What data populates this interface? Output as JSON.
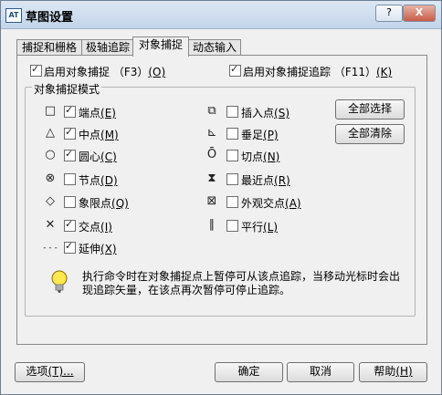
{
  "window": {
    "title": "草图设置",
    "app_icon_text": "AT",
    "help_btn": "?",
    "close_btn": "X"
  },
  "tabs": [
    {
      "label": "捕捉和栅格"
    },
    {
      "label": "极轴追踪"
    },
    {
      "label": "对象捕捉"
    },
    {
      "label": "动态输入"
    }
  ],
  "top_options": {
    "snap_on": {
      "label": "启用对象捕捉 （F3）",
      "mnem": "(O)",
      "checked": true
    },
    "track_on": {
      "label": "启用对象捕捉追踪 （F11）",
      "mnem": "(K)",
      "checked": true
    }
  },
  "group_title": "对象捕捉模式",
  "modes_left": [
    {
      "symbol": "□",
      "icon": "endpoint-icon",
      "label": "端点",
      "mnem": "(E)",
      "checked": true
    },
    {
      "symbol": "△",
      "icon": "midpoint-icon",
      "label": "中点",
      "mnem": "(M)",
      "checked": true
    },
    {
      "symbol": "○",
      "icon": "center-icon",
      "label": "圆心",
      "mnem": "(C)",
      "checked": true
    },
    {
      "symbol": "⊗",
      "icon": "node-icon",
      "label": "节点",
      "mnem": "(D)",
      "checked": false
    },
    {
      "symbol": "◇",
      "icon": "quadrant-icon",
      "label": "象限点",
      "mnem": "(Q)",
      "checked": false
    },
    {
      "symbol": "✕",
      "icon": "intersection-icon",
      "label": "交点",
      "mnem": "(I)",
      "checked": true
    },
    {
      "symbol": "- - -",
      "icon": "extension-icon",
      "label": "延伸",
      "mnem": "(X)",
      "checked": true
    }
  ],
  "modes_right": [
    {
      "symbol": "⧉",
      "icon": "insertion-icon",
      "label": "插入点",
      "mnem": "(S)",
      "checked": false
    },
    {
      "symbol": "⊾",
      "icon": "perpendicular-icon",
      "label": "垂足",
      "mnem": "(P)",
      "checked": false
    },
    {
      "symbol": "Ō",
      "icon": "tangent-icon",
      "label": "切点",
      "mnem": "(N)",
      "checked": false
    },
    {
      "symbol": "⧗",
      "icon": "nearest-icon",
      "label": "最近点",
      "mnem": "(R)",
      "checked": false
    },
    {
      "symbol": "⊠",
      "icon": "apparent-intersection-icon",
      "label": "外观交点",
      "mnem": "(A)",
      "checked": false
    },
    {
      "symbol": "∥",
      "icon": "parallel-icon",
      "label": "平行",
      "mnem": "(L)",
      "checked": false
    }
  ],
  "buttons": {
    "select_all": "全部选择",
    "clear_all": "全部清除",
    "options": "选项",
    "options_mnem": "(T)...",
    "ok": "确定",
    "cancel": "取消",
    "help": "帮助",
    "help_mnem": "(H)"
  },
  "info_text": "执行命令时在对象捕捉点上暂停可从该点追踪，当移动光标时会出现追踪矢量，在该点再次暂停可停止追踪。"
}
